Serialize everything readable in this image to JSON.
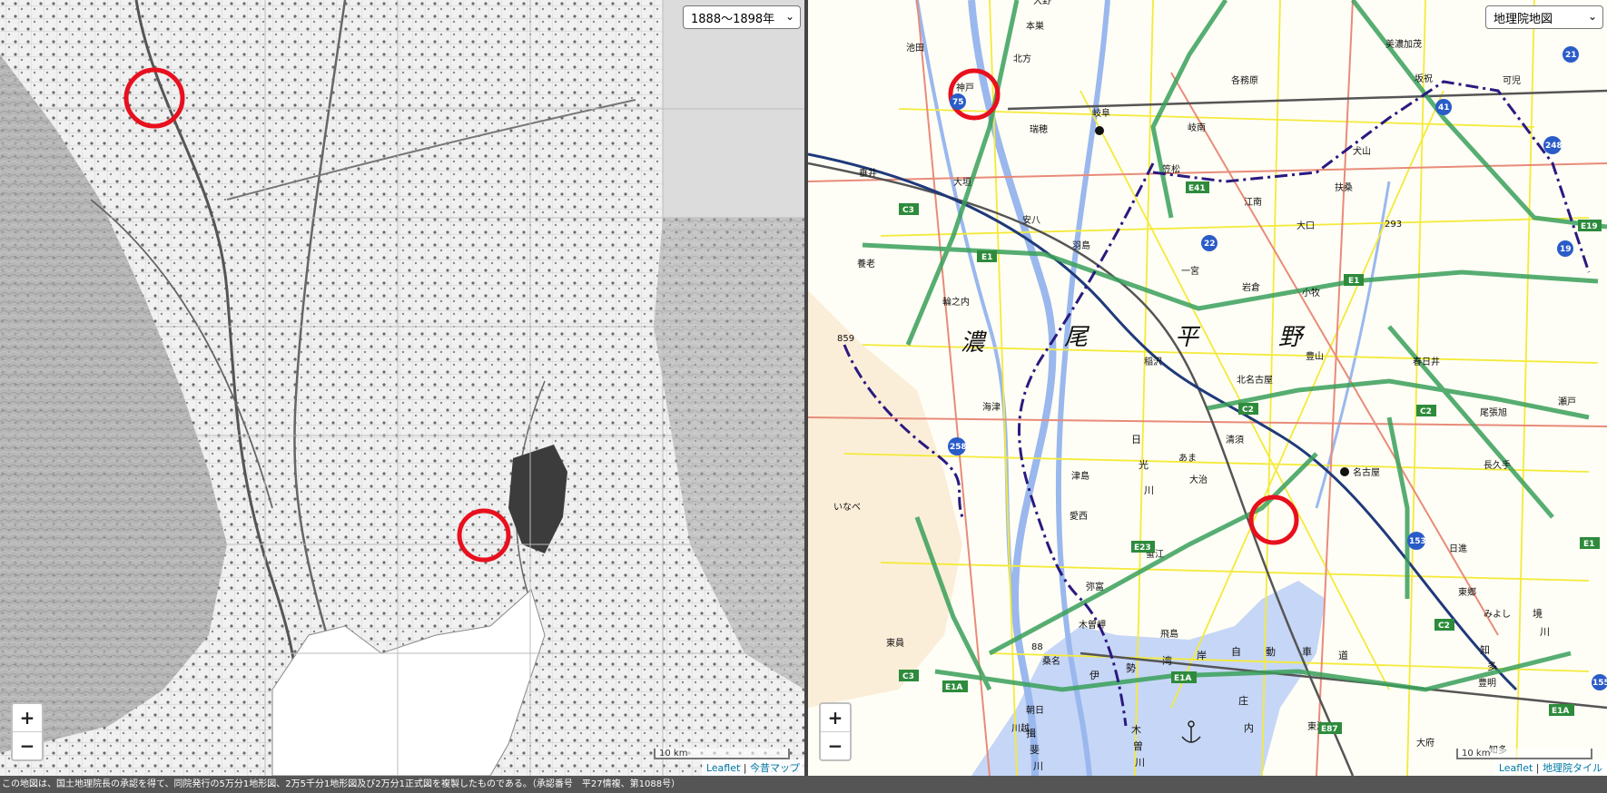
{
  "left_map": {
    "era_select": "1888～1898年",
    "zoom_in": "+",
    "zoom_out": "−",
    "scale": "10 km",
    "attr_leaflet": "Leaflet",
    "attr_sep": "|",
    "attr_source": "今昔マップ"
  },
  "right_map": {
    "layer_select": "地理院地図",
    "zoom_in": "+",
    "zoom_out": "−",
    "scale": "10 km",
    "attr_leaflet": "Leaflet",
    "attr_sep": "|",
    "attr_source": "地理院タイル",
    "places": {
      "p1": "大野",
      "p2": "本巣",
      "p3": "池田",
      "p4": "北方",
      "p5": "神戸",
      "p6": "美濃加茂",
      "p7": "坂祝",
      "p8": "可児",
      "p9": "各務原",
      "p10": "瑞穂",
      "p11": "岐阜",
      "p12": "岐南",
      "p13": "垂井",
      "p14": "大垣",
      "p15": "笠松",
      "p16": "犬山",
      "p17": "扶桑",
      "p18": "安八",
      "p19": "江南",
      "p20": "大口",
      "p21": "293",
      "p22": "羽島",
      "p23": "養老",
      "p24": "一宮",
      "p25": "岩倉",
      "p26": "小牧",
      "p27": "輪之内",
      "p28": "859",
      "p29": "稲沢",
      "p30": "豊山",
      "p31": "春日井",
      "p32": "北名古屋",
      "p33": "瀬戸",
      "p34": "海津",
      "p35": "尾張旭",
      "p36": "清須",
      "p37": "あま",
      "p38": "大治",
      "p39": "名古屋",
      "p40": "長久手",
      "p41": "津島",
      "p42": "愛西",
      "p43": "いなべ",
      "p44": "日進",
      "p45": "蟹江",
      "p46": "弥富",
      "p47": "東郷",
      "p48": "みよし",
      "p49": "木曽岬",
      "p50": "飛島",
      "p51": "東員",
      "p52": "88",
      "p53": "桑名",
      "p54": "豊明",
      "p55": "朝日",
      "p56": "川越",
      "p57": "東海",
      "p58": "大府",
      "p59": "知多"
    },
    "plain_labels": [
      "濃",
      "尾",
      "平",
      "野"
    ],
    "rivers": {
      "nikko": [
        "日",
        "光",
        "川"
      ],
      "ibi": [
        "揖",
        "斐",
        "川"
      ],
      "kiso": [
        "木",
        "曽",
        "川"
      ],
      "sakai": [
        "境",
        "川"
      ],
      "ise": [
        "伊",
        "勢",
        "湾",
        "岸",
        "自",
        "動",
        "車",
        "道"
      ],
      "shonai": [
        "庄",
        "内"
      ],
      "chiryu": [
        "知",
        "多"
      ]
    },
    "shields": {
      "s1": "C3",
      "s2": "E1",
      "s3": "E41",
      "s4": "22",
      "s5": "E1",
      "s6": "C2",
      "s7": "C2",
      "s8": "E23",
      "s9": "E1A",
      "s10": "E1A",
      "s11": "C3",
      "s12": "E87",
      "s13": "C2",
      "s14": "E1A",
      "s15": "E1",
      "s16": "E19",
      "s17": "19",
      "s18": "21",
      "s19": "41",
      "s20": "248",
      "s21": "153",
      "s22": "155",
      "s23": "75",
      "s24": "258"
    },
    "misc": {
      "water_km": "ma1"
    }
  },
  "footer": "この地図は、国土地理院長の承認を得て、同院発行の5万分1地形図、2万5千分1地形図及び2万分1正式図を複製したものである。（承認番号　平27情複、第1088号）",
  "colors": {
    "highlight_circle": "#e8101e",
    "expressway": "#3aa05a",
    "prefecture_border": "#2a1a80"
  }
}
